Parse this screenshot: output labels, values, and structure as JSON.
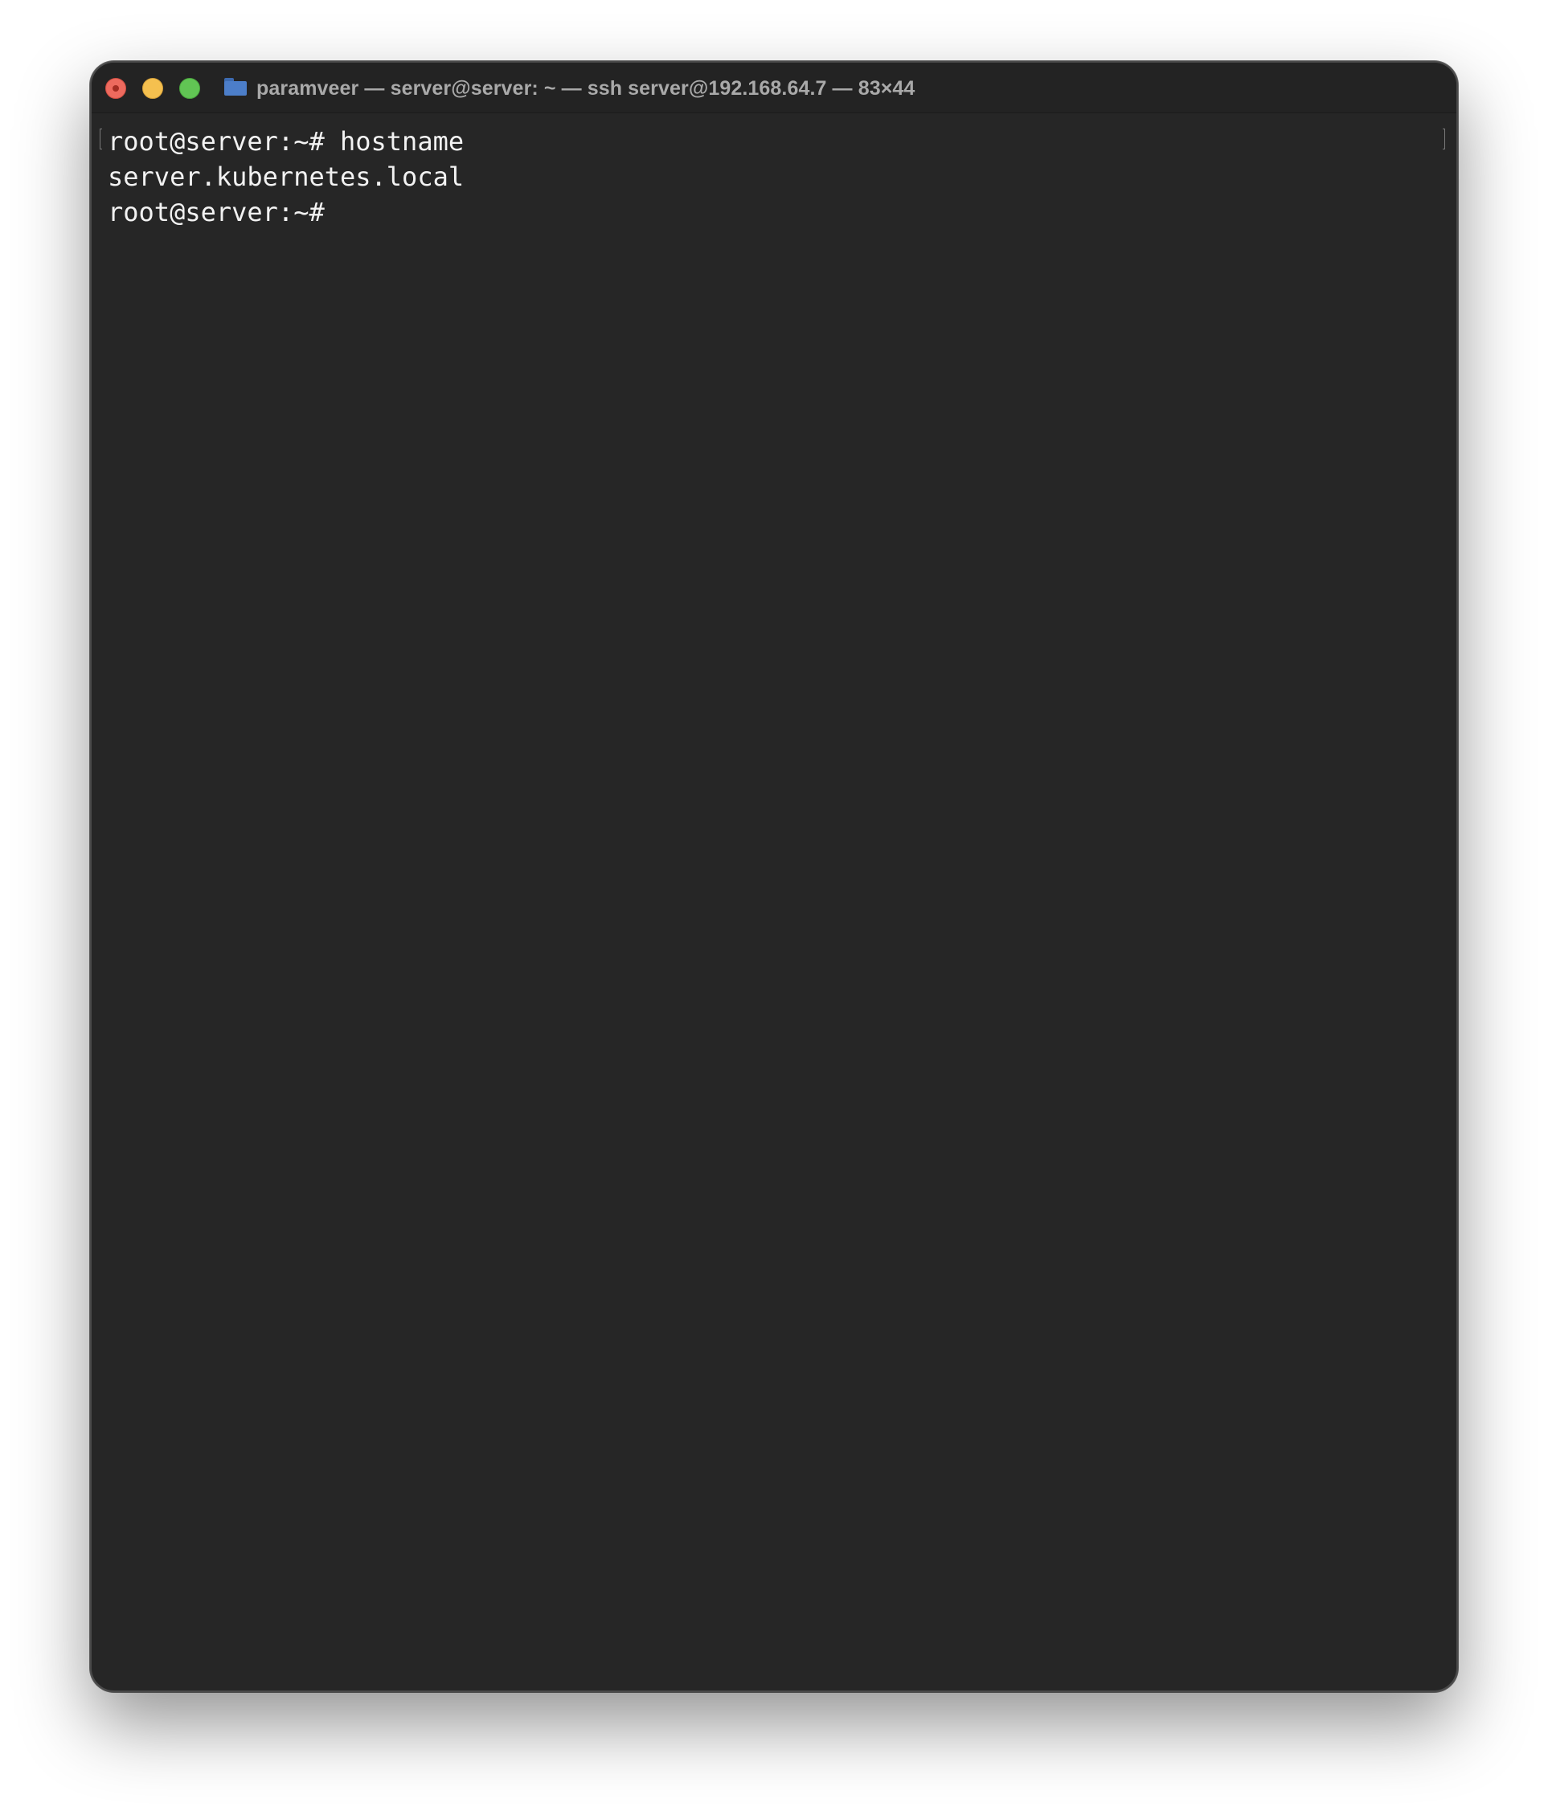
{
  "window": {
    "title": "paramveer — server@server: ~ — ssh server@192.168.64.7 — 83×44",
    "title_icon": "folder-icon",
    "colors": {
      "background": "#262626",
      "titlebar": "#232323",
      "text": "#f2f2f2",
      "close": "#ed6a5e",
      "minimize": "#f5c04f",
      "zoom": "#61c554"
    }
  },
  "terminal": {
    "lines": [
      "root@server:~# hostname",
      "server.kubernetes.local",
      "root@server:~#"
    ]
  }
}
